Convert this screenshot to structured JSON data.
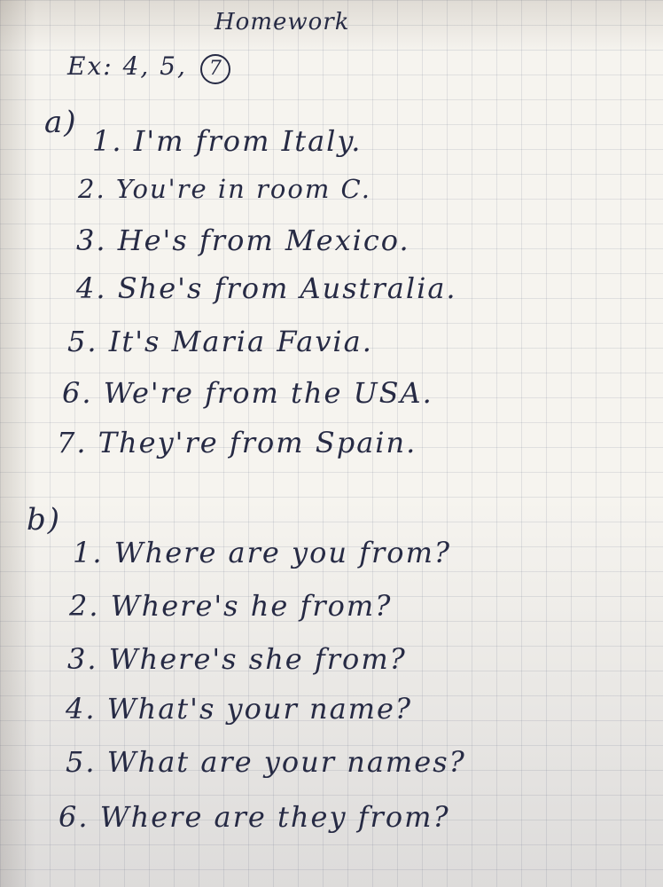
{
  "title": "Homework",
  "exercise": {
    "label": "Ex: 4, 5,",
    "circled": "7"
  },
  "section_a": {
    "label": "a)",
    "lines": [
      "1. I'm from Italy.",
      "2. You're in room C.",
      "3. He's from Mexico.",
      "4. She's from Australia.",
      "5. It's Maria Favia.",
      "6. We're from the USA.",
      "7. They're from Spain."
    ]
  },
  "section_b": {
    "label": "b)",
    "lines": [
      "1. Where are you from?",
      "2. Where's he from?",
      "3. Where's she from?",
      "4. What's your name?",
      "5. What are your names?",
      "6. Where are they from?"
    ]
  }
}
